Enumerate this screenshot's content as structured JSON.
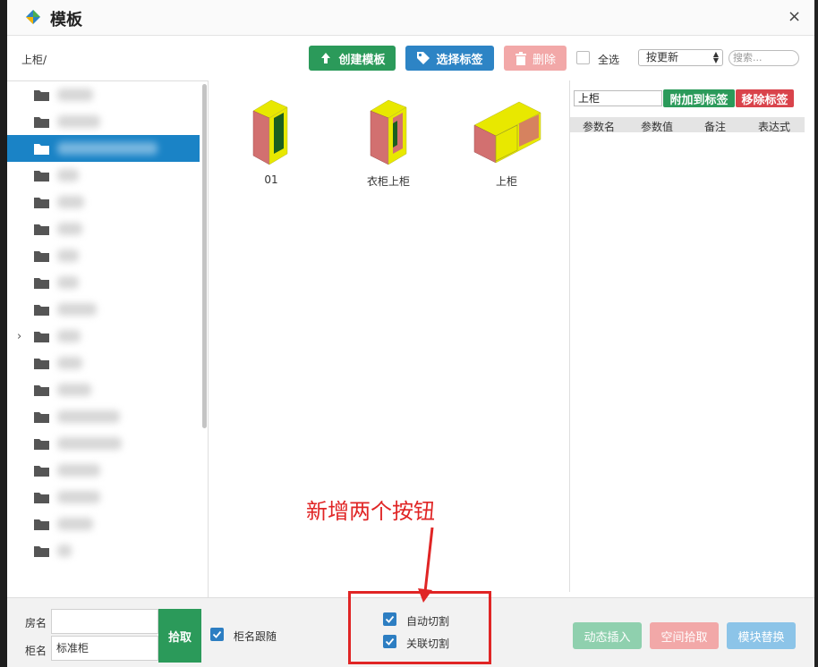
{
  "window": {
    "title": "模板",
    "close_glyph": "×",
    "logo_icon": "app-logo-icon"
  },
  "toolbar": {
    "path": "上柜/",
    "create_label": "创建模板",
    "select_tag_label": "选择标签",
    "delete_label": "删除",
    "select_all_label": "全选",
    "select_all_checked": false,
    "sort_value": "按更新",
    "search_placeholder": "搜索..."
  },
  "tree": {
    "folder_count": 18,
    "selected_index": 2,
    "expandable_index": 9,
    "expand_glyph": "›"
  },
  "templates": [
    {
      "name": "01"
    },
    {
      "name": "衣柜上柜"
    },
    {
      "name": "上柜"
    }
  ],
  "tag_panel": {
    "tag_value": "上柜",
    "add_label": "附加到标签",
    "remove_label": "移除标签",
    "columns": [
      "参数名",
      "参数值",
      "备注",
      "表达式"
    ]
  },
  "bottom": {
    "room_label": "房名",
    "room_value": "",
    "cabinet_label": "柜名",
    "cabinet_value": "标准柜",
    "pick_label": "拾取",
    "follow_label": "柜名跟随",
    "follow_checked": true,
    "auto_cut_label": "自动切割",
    "auto_cut_checked": true,
    "linked_cut_label": "关联切割",
    "linked_cut_checked": true,
    "dynamic_insert_label": "动态插入",
    "space_pick_label": "空间拾取",
    "module_replace_label": "模块替换"
  },
  "annotation": {
    "text": "新增两个按钮"
  },
  "colors": {
    "green": "#2b9a5a",
    "blue": "#2d84c5",
    "selected": "#1a83c6",
    "red_annotation": "#e02525"
  }
}
